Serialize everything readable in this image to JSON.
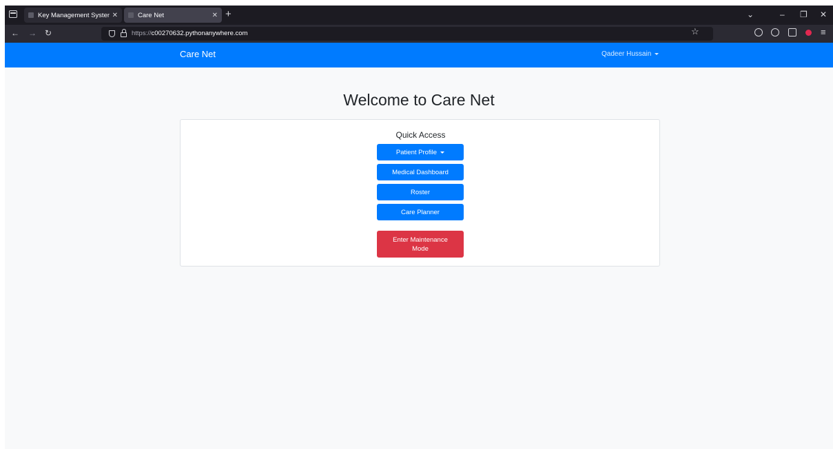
{
  "browser": {
    "tabs": [
      {
        "title": "Key Management System",
        "active": false
      },
      {
        "title": "Care Net",
        "active": true
      }
    ],
    "url_protocol": "https://",
    "url_host": "c00270632.pythonanywhere.com"
  },
  "navbar": {
    "brand": "Care Net",
    "user": "Qadeer Hussain"
  },
  "page": {
    "heading": "Welcome to Care Net",
    "quick_access": {
      "title": "Quick Access",
      "buttons": {
        "patient_profile": "Patient Profile",
        "medical_dashboard": "Medical Dashboard",
        "roster": "Roster",
        "care_planner": "Care Planner",
        "maintenance": "Enter Maintenance Mode"
      }
    }
  },
  "colors": {
    "primary": "#007bff",
    "danger": "#dc3545",
    "page_background": "#f8f9fa",
    "browser_chrome": "#1c1b22"
  }
}
